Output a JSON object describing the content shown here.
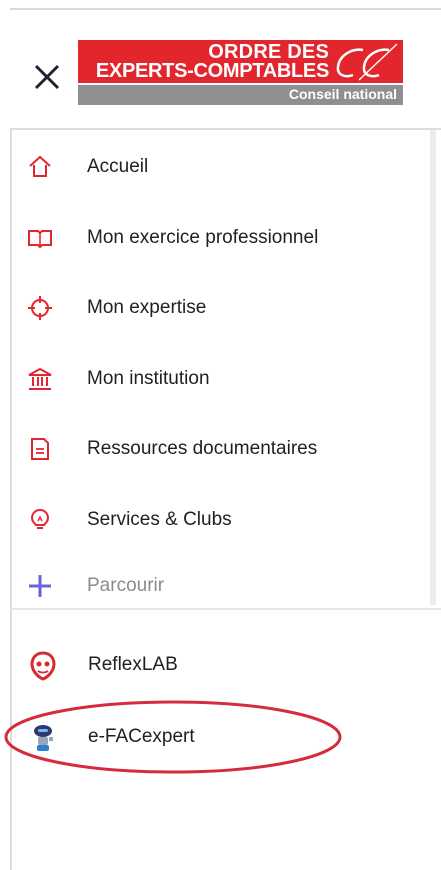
{
  "header": {
    "close_label": "Close menu",
    "logo": {
      "line1": "ORDRE DES",
      "line2": "EXPERTS-COMPTABLES",
      "subtitle": "Conseil national"
    }
  },
  "menu": {
    "items": [
      {
        "label": "Accueil",
        "icon": "home-icon"
      },
      {
        "label": "Mon exercice professionnel",
        "icon": "book-icon"
      },
      {
        "label": "Mon expertise",
        "icon": "crosshair-icon"
      },
      {
        "label": "Mon institution",
        "icon": "institution-icon"
      },
      {
        "label": "Ressources documentaires",
        "icon": "document-icon"
      },
      {
        "label": "Services & Clubs",
        "icon": "lightbulb-icon"
      },
      {
        "label": "Parcourir",
        "icon": "plus-icon"
      }
    ]
  },
  "tools": {
    "items": [
      {
        "label": "ReflexLAB",
        "icon": "reflexlab-icon"
      },
      {
        "label": "e-FACexpert",
        "icon": "robot-icon",
        "highlighted": true
      }
    ]
  },
  "colors": {
    "brand_red": "#e3262e",
    "icon_red": "#e3262e",
    "accent_purple": "#6b63d6",
    "logo_gray": "#8f8f91",
    "highlight_ellipse": "#d42b3d"
  }
}
